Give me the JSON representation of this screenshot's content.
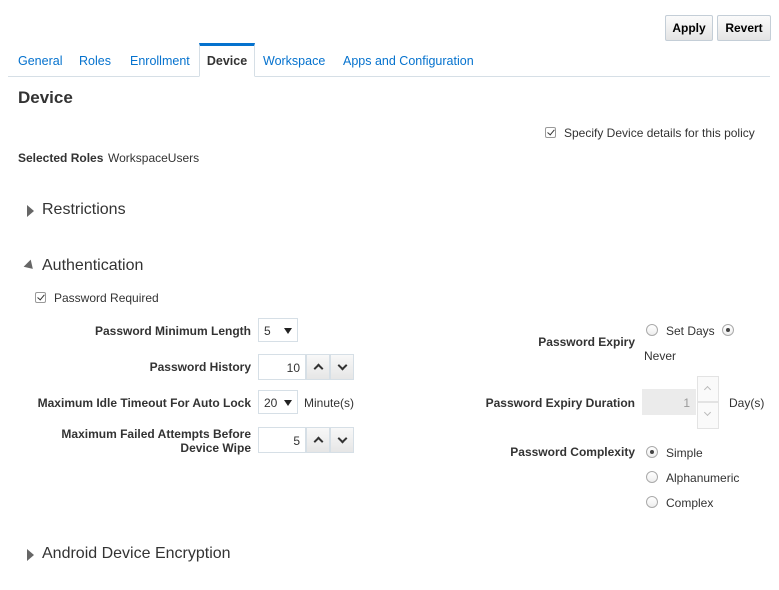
{
  "toolbar": {
    "apply": "Apply",
    "revert": "Revert"
  },
  "tabs": [
    "General",
    "Roles",
    "Enrollment",
    "Device",
    "Workspace",
    "Apps and Configuration"
  ],
  "active_tab": "Device",
  "page_title": "Device",
  "specify_device": {
    "label": "Specify Device details for this policy",
    "checked": true
  },
  "selected_roles": {
    "label": "Selected Roles",
    "value": "WorkspaceUsers"
  },
  "sections": {
    "restrictions": "Restrictions",
    "authentication": "Authentication",
    "encryption": "Android Device Encryption"
  },
  "password_required": {
    "label": "Password Required",
    "checked": true
  },
  "fields": {
    "min_length": {
      "label": "Password Minimum Length",
      "value": "5"
    },
    "history": {
      "label": "Password History",
      "value": "10"
    },
    "idle_timeout": {
      "label": "Maximum Idle Timeout For Auto Lock",
      "value": "20",
      "unit": "Minute(s)"
    },
    "failed_attempts": {
      "label_line1": "Maximum Failed Attempts Before",
      "label_line2": "Device Wipe",
      "value": "5"
    },
    "expiry": {
      "label": "Password Expiry",
      "option_set_days": "Set Days",
      "option_never": "Never",
      "selected": "Never"
    },
    "expiry_duration": {
      "label": "Password Expiry Duration",
      "value": "1",
      "unit": "Day(s)"
    },
    "complexity": {
      "label": "Password Complexity",
      "options": [
        "Simple",
        "Alphanumeric",
        "Complex"
      ],
      "selected": "Simple"
    }
  }
}
